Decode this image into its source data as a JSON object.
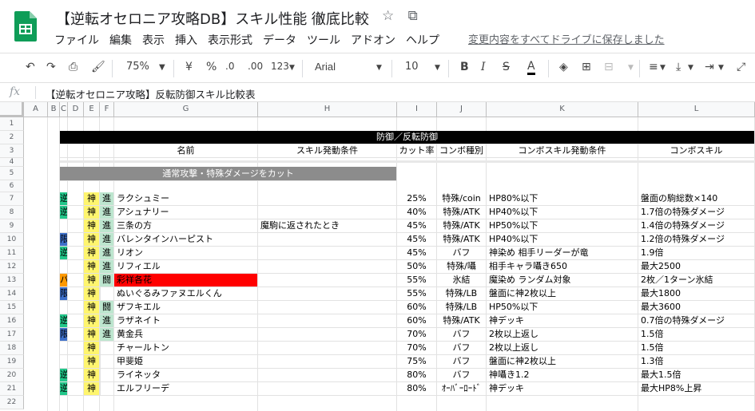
{
  "doc": {
    "title": "【逆転オセロニア攻略DB】スキル性能 徹底比較",
    "saved_status": "変更内容をすべてドライブに保存しました",
    "menu": [
      "ファイル",
      "編集",
      "表示",
      "挿入",
      "表示形式",
      "データ",
      "ツール",
      "アドオン",
      "ヘルプ"
    ]
  },
  "toolbar": {
    "zoom": "75%",
    "currency": "¥",
    "percent": "%",
    "dec_less": ".0",
    "dec_more": ".00",
    "format_more": "123",
    "font": "Arial",
    "font_size": "10",
    "bold": "B",
    "text_color_glyph": "A"
  },
  "formula_bar": {
    "fx": "fx",
    "value": "【逆転オセロニア攻略】反転防御スキル比較表"
  },
  "columns": [
    "A",
    "B",
    "C",
    "D",
    "E",
    "F",
    "G",
    "H",
    "I",
    "J",
    "K",
    "L"
  ],
  "sheet": {
    "banner": "防御／反転防御",
    "headers": {
      "name": "名前",
      "skill_cond": "スキル発動条件",
      "cut_rate": "カット率",
      "combo_type": "コンボ種別",
      "combo_cond": "コンボスキル発動条件",
      "combo_skill": "コンボスキル"
    },
    "section": "通常攻撃・特殊ダメージをカット",
    "rows": [
      {
        "n": "7",
        "type": "逆",
        "attr": "神",
        "rank": "S",
        "evo": "進",
        "name": "ラクシュミー",
        "cond": "",
        "cut": "25%",
        "ctype": "特殊/coin",
        "ccond": "HP80%以下",
        "cskill": "盤面の駒総数×140"
      },
      {
        "n": "8",
        "type": "逆",
        "attr": "神",
        "rank": "S",
        "evo": "進",
        "name": "アシュナリー",
        "cond": "",
        "cut": "40%",
        "ctype": "特殊/ATK",
        "ccond": "HP40%以下",
        "cskill": "1.7倍の特殊ダメージ"
      },
      {
        "n": "9",
        "type": "",
        "attr": "神",
        "rank": "A",
        "evo": "進",
        "name": "三条の方",
        "cond": "魔駒に返されたとき",
        "cut": "45%",
        "ctype": "特殊/ATK",
        "ccond": "HP50%以下",
        "cskill": "1.4倍の特殊ダメージ"
      },
      {
        "n": "10",
        "type": "限",
        "attr": "神",
        "rank": "A",
        "evo": "進",
        "name": "バレンタインハーピスト",
        "cond": "",
        "cut": "45%",
        "ctype": "特殊/ATK",
        "ccond": "HP40%以下",
        "cskill": "1.2倍の特殊ダメージ"
      },
      {
        "n": "11",
        "type": "逆",
        "attr": "神",
        "rank": "A",
        "evo": "進",
        "name": "リオン",
        "cond": "",
        "cut": "45%",
        "ctype": "バフ",
        "ccond": "神染め 相手リーダーが竜",
        "cskill": "1.9倍"
      },
      {
        "n": "12",
        "type": "",
        "attr": "神",
        "rank": "A",
        "evo": "進",
        "name": "リフィエル",
        "cond": "",
        "cut": "50%",
        "ctype": "特殊/囁",
        "ccond": "相手キャラ囁き650",
        "cskill": "最大2500"
      },
      {
        "n": "13",
        "type": "パ",
        "attr": "神",
        "rank": "A",
        "evo": "闘",
        "name": "彩祥各花",
        "cond": "",
        "cut": "55%",
        "ctype": "氷結",
        "ccond": "魔染め ランダム対象",
        "cskill": "2枚／1ターン氷結"
      },
      {
        "n": "14",
        "type": "限",
        "attr": "神",
        "rank": "B",
        "evo": "",
        "name": "ぬいぐるみファヌエルくん",
        "cond": "",
        "cut": "55%",
        "ctype": "特殊/LB",
        "ccond": "盤面に神2枚以上",
        "cskill": "最大1800"
      },
      {
        "n": "15",
        "type": "",
        "attr": "神",
        "rank": "A",
        "evo": "闘",
        "name": "ザフキエル",
        "cond": "",
        "cut": "60%",
        "ctype": "特殊/LB",
        "ccond": "HP50%以下",
        "cskill": "最大3600"
      },
      {
        "n": "16",
        "type": "逆",
        "attr": "神",
        "rank": "A",
        "evo": "進",
        "name": "ラザネイト",
        "cond": "",
        "cut": "60%",
        "ctype": "特殊/ATK",
        "ccond": "神デッキ",
        "cskill": "0.7倍の特殊ダメージ"
      },
      {
        "n": "17",
        "type": "限",
        "attr": "神",
        "rank": "A",
        "evo": "進",
        "name": "黄金兵",
        "cond": "",
        "cut": "70%",
        "ctype": "バフ",
        "ccond": "2枚以上返し",
        "cskill": "1.5倍"
      },
      {
        "n": "18",
        "type": "",
        "attr": "神",
        "rank": "B",
        "evo": "",
        "name": "チャールトン",
        "cond": "",
        "cut": "70%",
        "ctype": "バフ",
        "ccond": "2枚以上返し",
        "cskill": "1.5倍"
      },
      {
        "n": "19",
        "type": "",
        "attr": "神",
        "rank": "B",
        "evo": "",
        "name": "甲斐姫",
        "cond": "",
        "cut": "75%",
        "ctype": "バフ",
        "ccond": "盤面に神2枚以上",
        "cskill": "1.3倍"
      },
      {
        "n": "20",
        "type": "逆",
        "attr": "神",
        "rank": "B",
        "evo": "",
        "name": "ライネッタ",
        "cond": "",
        "cut": "80%",
        "ctype": "バフ",
        "ccond": "神囁き1.2",
        "cskill": "最大1.5倍"
      },
      {
        "n": "21",
        "type": "逆",
        "attr": "神",
        "rank": "B",
        "evo": "",
        "name": "エルフリーデ",
        "cond": "",
        "cut": "80%",
        "ctype": "ｵｰﾊﾞｰﾛｰﾄﾞ",
        "ccond": "神デッキ",
        "cskill": "最大HP8%上昇"
      }
    ]
  },
  "colors": {
    "type_逆": "#22c78a",
    "type_限": "#3d6fc9",
    "type_パ": "#ff9900",
    "attr_神": "#fff56e",
    "rank_S": "#6d6d6d",
    "rank_A": "#f39a4d",
    "evo_cell": "#bde6cf",
    "highlight_row13": "#ff0000",
    "banner": "#000000",
    "section": "#8c8c8c"
  }
}
